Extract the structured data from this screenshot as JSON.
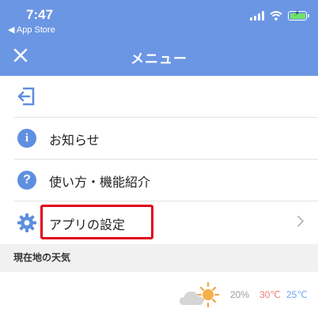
{
  "status_bar": {
    "time": "7:47",
    "back_label": "◀ App Store"
  },
  "nav": {
    "title": "メニュー"
  },
  "menu": {
    "items": [
      {
        "label": ""
      },
      {
        "label": "お知らせ"
      },
      {
        "label": "使い方・機能紹介"
      },
      {
        "label": "アプリの設定"
      }
    ]
  },
  "weather": {
    "section_title": "現在地の天気",
    "precip": "20%",
    "high": "30℃",
    "low": "25℃"
  },
  "colors": {
    "header": "#6b96e3",
    "icon_blue": "#5f8fe0",
    "highlight": "#e0001c",
    "temp_high": "#ef7a7a",
    "temp_low": "#6aa6f0"
  },
  "icons": {
    "close": "close-icon",
    "logout": "logout-icon",
    "info": "info-icon",
    "help": "question-icon",
    "settings": "gear-icon",
    "chevron": "chevron-right-icon",
    "weather": "cloud-sun-icon"
  }
}
